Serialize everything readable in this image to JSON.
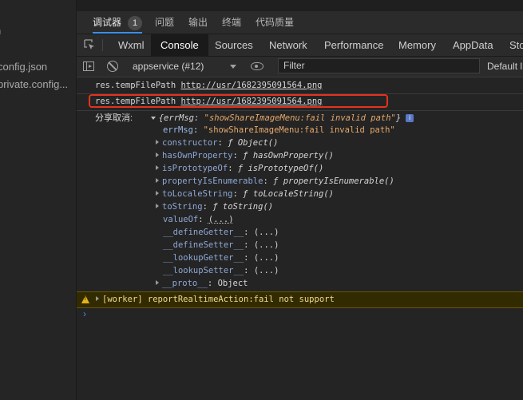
{
  "sidebar": {
    "items": [
      "n",
      "s",
      "config.json",
      "private.config..."
    ]
  },
  "panel_tabs": [
    {
      "label": "调试器",
      "count": "1"
    },
    {
      "label": "问题"
    },
    {
      "label": "输出"
    },
    {
      "label": "终端"
    },
    {
      "label": "代码质量"
    }
  ],
  "devtools_tabs": [
    "Wxml",
    "Console",
    "Sources",
    "Network",
    "Performance",
    "Memory",
    "AppData",
    "Sto"
  ],
  "active_devtools_tab": "Console",
  "toolbar": {
    "context": "appservice (#12)",
    "filter_placeholder": "Filter",
    "levels": "Default l"
  },
  "console": {
    "log1": {
      "label": "res.tempFilePath",
      "url": "http://usr/1682395091564.png"
    },
    "log2": {
      "label": "res.tempFilePath",
      "url": "http://usr/1682395091564.png"
    },
    "error_prefix": "分享取消:",
    "object_summary": {
      "key": "errMsg",
      "value": "\"showShareImageMenu:fail invalid path\""
    },
    "errMsg": {
      "key": "errMsg",
      "value": "\"showShareImageMenu:fail invalid path\""
    },
    "props": [
      {
        "key": "constructor",
        "value": "ƒ Object()"
      },
      {
        "key": "hasOwnProperty",
        "value": "ƒ hasOwnProperty()"
      },
      {
        "key": "isPrototypeOf",
        "value": "ƒ isPrototypeOf()"
      },
      {
        "key": "propertyIsEnumerable",
        "value": "ƒ propertyIsEnumerable()"
      },
      {
        "key": "toLocaleString",
        "value": "ƒ toLocaleString()"
      },
      {
        "key": "toString",
        "value": "ƒ toString()"
      }
    ],
    "valueOf": {
      "key": "valueOf",
      "value": "(...)"
    },
    "accessors": [
      {
        "key": "__defineGetter__",
        "value": "(...)"
      },
      {
        "key": "__defineSetter__",
        "value": "(...)"
      },
      {
        "key": "__lookupGetter__",
        "value": "(...)"
      },
      {
        "key": "__lookupSetter__",
        "value": "(...)"
      }
    ],
    "proto": {
      "key": "__proto__",
      "value": "Object"
    },
    "warning": "[worker] reportRealtimeAction:fail not support",
    "prompt": "›"
  },
  "colors": {
    "accent": "#3c8ee6",
    "highlight_box": "#e2331e",
    "warning": "#e7b415"
  }
}
